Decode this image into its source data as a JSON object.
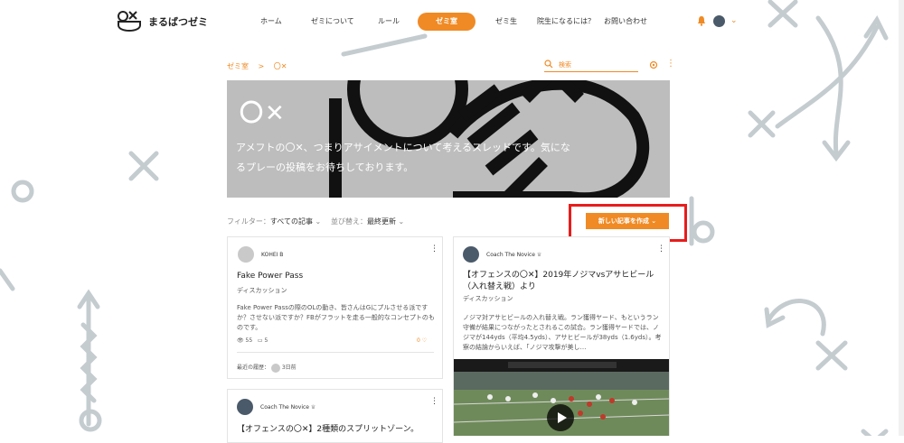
{
  "brand": {
    "name": "まるばつゼミ",
    "accent": "#f08a24"
  },
  "nav": {
    "items": [
      {
        "label": "ホーム"
      },
      {
        "label": "ゼミについて"
      },
      {
        "label": "ルール"
      },
      {
        "label": "ゼミ室",
        "active": true
      },
      {
        "label": "ゼミ生"
      },
      {
        "label": "院生になるには？"
      },
      {
        "label": "お問い合わせ"
      }
    ]
  },
  "breadcrumb": {
    "root": "ゼミ室",
    "sep": ">",
    "current": "〇✕"
  },
  "search": {
    "placeholder": "検索"
  },
  "hero": {
    "title": "〇✕",
    "description": "アメフトの〇✕、つまりアサイメントについて考えるスレッドです。気になるプレーの投稿をお待ちしております。"
  },
  "filter": {
    "label": "フィルター：",
    "value": "すべての記事"
  },
  "sort": {
    "label": "並び替え：",
    "value": "最終更新"
  },
  "new_post_button": "新しい記事を作成",
  "posts": [
    {
      "author": "KOHEI B",
      "title": "Fake Power Pass",
      "category": "ディスカッション",
      "excerpt": "Fake Power Passの際のOLの動き、皆さんはGにプルさせる派ですか？させない派ですか？FBがフラットを走る一般的なコンセプトのものです。",
      "views": "55",
      "comments": "5",
      "likes": "0",
      "activity_label": "最近の履歴：",
      "activity_time": "3日前"
    },
    {
      "author": "Coach The Novice",
      "title": "【オフェンスの〇✕】2019年ノジマvsアサヒビール（入れ替え戦）より",
      "category": "ディスカッション",
      "excerpt": "ノジマ対アサヒビールの入れ替え戦。ラン獲得ヤード、もというラン守備が結果につながったとされるこの試合。ラン獲得ヤードでは、ノジマが144yds（平均4.5yds）、アサヒビールが38yds（1.6yds）。考察の結論からいえば、「ノジマ攻撃が美し…"
    },
    {
      "author": "Coach The Novice",
      "title": "【オフェンスの〇✕】2種類のスプリットゾーン。"
    }
  ]
}
